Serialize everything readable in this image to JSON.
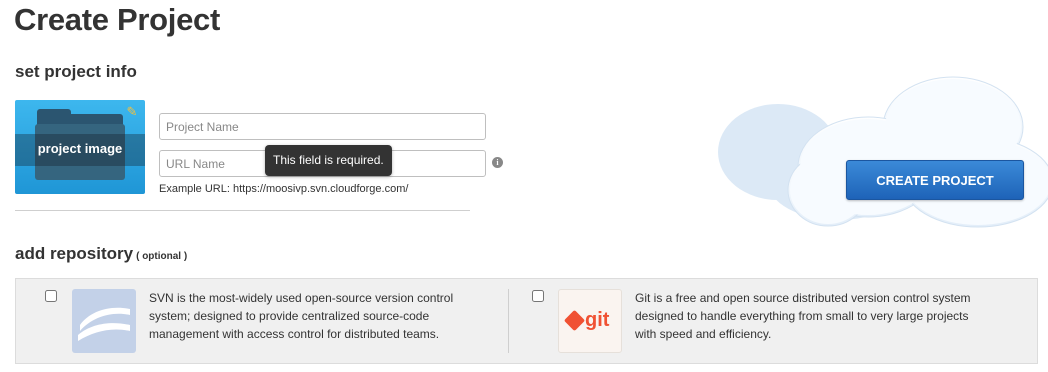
{
  "page": {
    "title": "Create Project"
  },
  "project_info": {
    "heading": "set project info",
    "image_label": "project image",
    "name_placeholder": "Project Name",
    "url_placeholder": "URL Name",
    "tooltip": "This field is required.",
    "example_url": "Example URL: https://moosivp.svn.cloudforge.com/"
  },
  "actions": {
    "create_label": "CREATE PROJECT"
  },
  "repository": {
    "heading": "add repository",
    "optional_label": "( optional )",
    "options": [
      {
        "name": "svn",
        "description": "SVN is the most-widely used open-source version control system; designed to provide centralized source-code management with access control for distributed teams.",
        "checked": false
      },
      {
        "name": "git",
        "logo_text": "git",
        "description": "Git is a free and open source distributed version control system designed to handle everything from small to very large projects with speed and efficiency.",
        "checked": false
      }
    ]
  },
  "icons": {
    "edit": "pencil-icon",
    "info": "info-icon",
    "folder": "folder-icon"
  },
  "colors": {
    "accent_blue": "#2a74c9",
    "git_orange": "#f05133",
    "tooltip_bg": "#333333"
  }
}
